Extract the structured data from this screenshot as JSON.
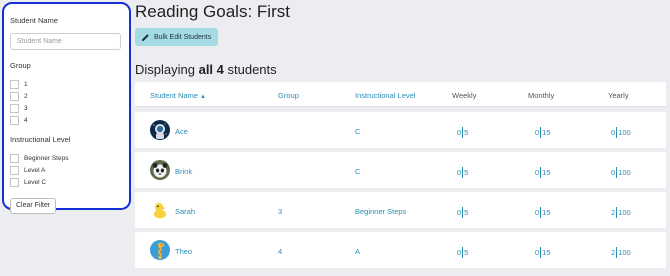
{
  "sidebar": {
    "student_name_heading": "Student Name",
    "student_name_placeholder": "Student Name",
    "group_heading": "Group",
    "groups": [
      "1",
      "2",
      "3",
      "4"
    ],
    "il_heading": "Instructional Level",
    "levels": [
      "Beginner Steps",
      "Level A",
      "Level C"
    ],
    "clear_filter": "Clear Filter"
  },
  "page": {
    "title": "Reading Goals: First",
    "bulk_edit": "Bulk Edit Students",
    "displaying_prefix": "Displaying ",
    "displaying_count": "all 4",
    "displaying_suffix": " students"
  },
  "table": {
    "headers": {
      "student_name": "Student Name",
      "sort_arrow": "▲",
      "group": "Group",
      "instructional_level": "Instructional Level",
      "weekly": "Weekly",
      "monthly": "Monthly",
      "yearly": "Yearly"
    },
    "rows": [
      {
        "name": "Ace",
        "avatar": "astronaut-avatar-icon",
        "group": "",
        "level": "C",
        "weekly": [
          "0",
          "5"
        ],
        "monthly": [
          "0",
          "15"
        ],
        "yearly": [
          "0",
          "100"
        ]
      },
      {
        "name": "Brink",
        "avatar": "panda-avatar-icon",
        "group": "",
        "level": "C",
        "weekly": [
          "0",
          "5"
        ],
        "monthly": [
          "0",
          "15"
        ],
        "yearly": [
          "0",
          "100"
        ]
      },
      {
        "name": "Sarah",
        "avatar": "duck-avatar-icon",
        "group": "3",
        "level": "Beginner Steps",
        "weekly": [
          "0",
          "5"
        ],
        "monthly": [
          "0",
          "15"
        ],
        "yearly": [
          "2",
          "100"
        ]
      },
      {
        "name": "Theo",
        "avatar": "giraffe-avatar-icon",
        "group": "4",
        "level": "A",
        "weekly": [
          "0",
          "5"
        ],
        "monthly": [
          "0",
          "15"
        ],
        "yearly": [
          "2",
          "100"
        ]
      }
    ]
  },
  "colors": {
    "accent": "#2c8eb3",
    "highlight_border": "#1530d6",
    "bulk_button": "#a5dbe3",
    "background": "#ecedf0"
  }
}
